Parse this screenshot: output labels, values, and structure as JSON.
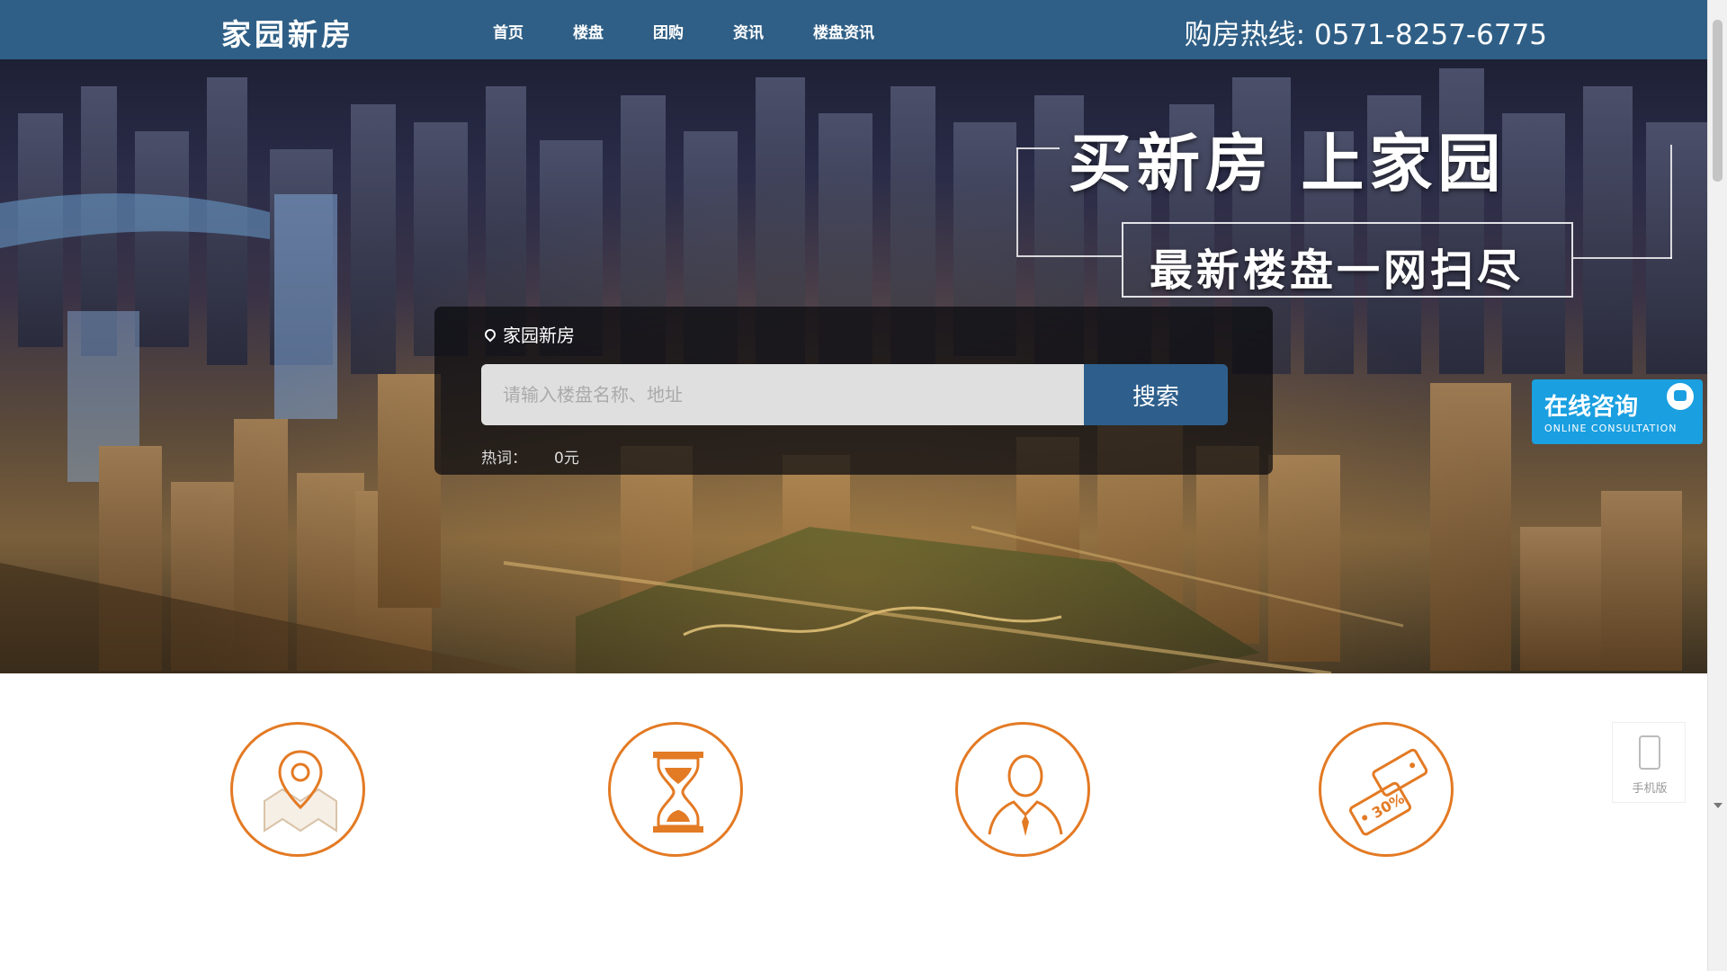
{
  "header": {
    "brand": "家园新房",
    "nav": [
      "首页",
      "楼盘",
      "团购",
      "资讯",
      "楼盘资讯"
    ],
    "hotline": "购房热线: 0571-8257-6775"
  },
  "hero": {
    "slogan_main": "买新房 上家园",
    "slogan_sub": "最新楼盘一网扫尽"
  },
  "search": {
    "location": "家园新房",
    "placeholder": "请输入楼盘名称、地址",
    "button": "搜索",
    "hot_label": "热词：",
    "hot_link": "0元"
  },
  "consult": {
    "title": "在线咨询",
    "subtitle": "ONLINE CONSULTATION"
  },
  "mobile": {
    "label": "手机版"
  },
  "features": [
    {
      "icon": "map-location-icon"
    },
    {
      "icon": "hourglass-icon"
    },
    {
      "icon": "agent-person-icon"
    },
    {
      "icon": "discount-tag-icon"
    }
  ],
  "colors": {
    "nav_bg": "#2f5f86",
    "search_button": "#2e5f8c",
    "consult": "#1a9fe0",
    "feature_accent": "#e37a24"
  }
}
